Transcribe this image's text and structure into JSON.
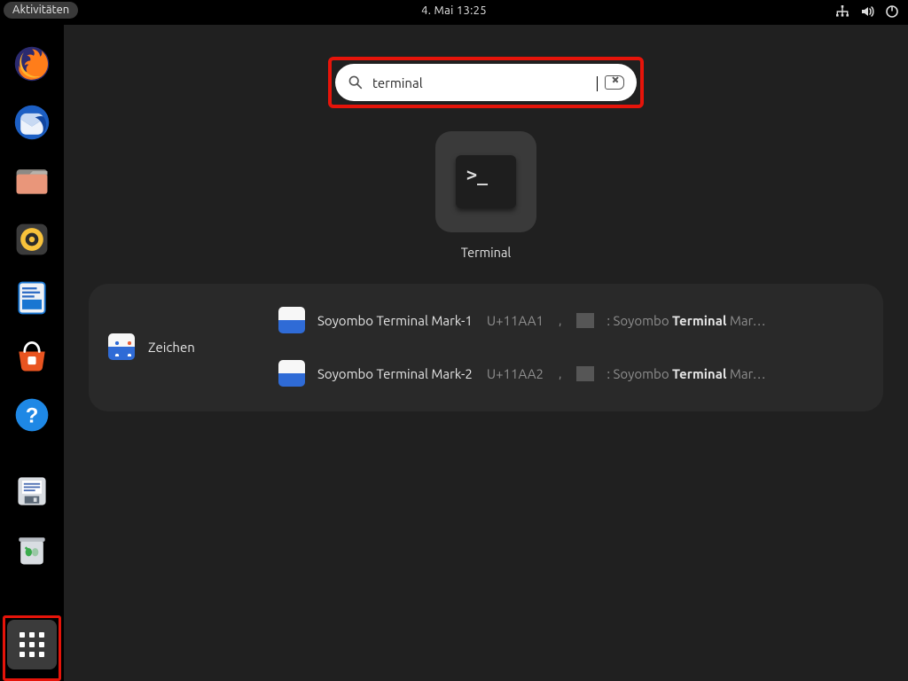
{
  "topbar": {
    "activities_label": "Aktivitäten",
    "clock": "4. Mai  13:25"
  },
  "dock": {
    "items": [
      {
        "name": "firefox"
      },
      {
        "name": "thunderbird"
      },
      {
        "name": "files"
      },
      {
        "name": "rhythmbox"
      },
      {
        "name": "libreoffice-writer"
      },
      {
        "name": "ubuntu-software"
      },
      {
        "name": "help"
      },
      {
        "name": "save"
      },
      {
        "name": "trash"
      }
    ],
    "apps_button": "Anwendungen anzeigen"
  },
  "search": {
    "query": "terminal"
  },
  "results": {
    "app": {
      "label": "Terminal",
      "prompt_glyph": ">_"
    },
    "providers": [
      {
        "source_label": "Zeichen",
        "chars": [
          {
            "name": "Soyombo Terminal Mark-1",
            "code": "U+11AA1",
            "desc_pre": ": Soyombo ",
            "desc_bold": "Terminal",
            "desc_post": " Mar…"
          },
          {
            "name": "Soyombo Terminal Mark-2",
            "code": "U+11AA2",
            "desc_pre": ": Soyombo ",
            "desc_bold": "Terminal",
            "desc_post": " Mar…"
          }
        ]
      }
    ]
  }
}
